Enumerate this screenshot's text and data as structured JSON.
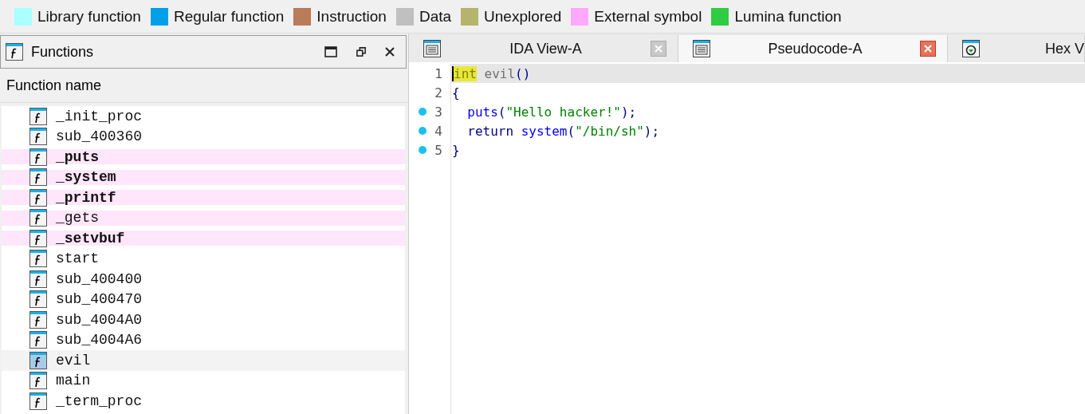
{
  "legend": [
    {
      "label": "Library function",
      "color": "#aaffff"
    },
    {
      "label": "Regular function",
      "color": "#00a0e8"
    },
    {
      "label": "Instruction",
      "color": "#b97b58"
    },
    {
      "label": "Data",
      "color": "#c0c0c0"
    },
    {
      "label": "Unexplored",
      "color": "#b4b46c"
    },
    {
      "label": "External symbol",
      "color": "#ffa8ff"
    },
    {
      "label": "Lumina function",
      "color": "#2ecc40"
    }
  ],
  "functions_panel": {
    "title": "Functions",
    "column": "Function name",
    "rows": [
      {
        "name": "_init_proc",
        "kind": "regular",
        "bold": false,
        "selected": false
      },
      {
        "name": "sub_400360",
        "kind": "regular",
        "bold": false,
        "selected": false
      },
      {
        "name": "_puts",
        "kind": "external",
        "bold": true,
        "selected": false
      },
      {
        "name": "_system",
        "kind": "external",
        "bold": true,
        "selected": false
      },
      {
        "name": "_printf",
        "kind": "external",
        "bold": true,
        "selected": false
      },
      {
        "name": "_gets",
        "kind": "external",
        "bold": false,
        "selected": false
      },
      {
        "name": "_setvbuf",
        "kind": "external",
        "bold": true,
        "selected": false
      },
      {
        "name": "start",
        "kind": "regular",
        "bold": false,
        "selected": false
      },
      {
        "name": "sub_400400",
        "kind": "regular",
        "bold": false,
        "selected": false
      },
      {
        "name": "sub_400470",
        "kind": "regular",
        "bold": false,
        "selected": false
      },
      {
        "name": "sub_4004A0",
        "kind": "regular",
        "bold": false,
        "selected": false
      },
      {
        "name": "sub_4004A6",
        "kind": "regular",
        "bold": false,
        "selected": false
      },
      {
        "name": "evil",
        "kind": "regular",
        "bold": false,
        "selected": true
      },
      {
        "name": "main",
        "kind": "regular",
        "bold": false,
        "selected": false
      },
      {
        "name": "_term_proc",
        "kind": "regular",
        "bold": false,
        "selected": false
      }
    ]
  },
  "tabs": [
    {
      "label": "IDA View-A",
      "kind": "listing",
      "selected": false
    },
    {
      "label": "Pseudocode-A",
      "kind": "listing",
      "selected": true
    },
    {
      "label": "Hex V",
      "kind": "hex",
      "selected": false
    }
  ],
  "code": [
    {
      "number": "1",
      "breakpoint": false,
      "selected": true,
      "tokens": [
        {
          "text": "int",
          "kind": "highlight"
        },
        {
          "text": " evil",
          "kind": "name"
        },
        {
          "text": "()",
          "kind": "punct"
        }
      ]
    },
    {
      "number": "2",
      "breakpoint": false,
      "selected": false,
      "tokens": [
        {
          "text": "{",
          "kind": "punct"
        }
      ]
    },
    {
      "number": "3",
      "breakpoint": true,
      "selected": false,
      "tokens": [
        {
          "text": "  puts",
          "kind": "func"
        },
        {
          "text": "(",
          "kind": "punct"
        },
        {
          "text": "\"Hello hacker!\"",
          "kind": "string"
        },
        {
          "text": ");",
          "kind": "punct"
        }
      ]
    },
    {
      "number": "4",
      "breakpoint": true,
      "selected": false,
      "tokens": [
        {
          "text": "  return ",
          "kind": "punct"
        },
        {
          "text": "system",
          "kind": "func"
        },
        {
          "text": "(",
          "kind": "punct"
        },
        {
          "text": "\"/bin/sh\"",
          "kind": "string"
        },
        {
          "text": ");",
          "kind": "punct"
        }
      ]
    },
    {
      "number": "5",
      "breakpoint": true,
      "selected": false,
      "tokens": [
        {
          "text": "}",
          "kind": "punct"
        }
      ]
    }
  ]
}
